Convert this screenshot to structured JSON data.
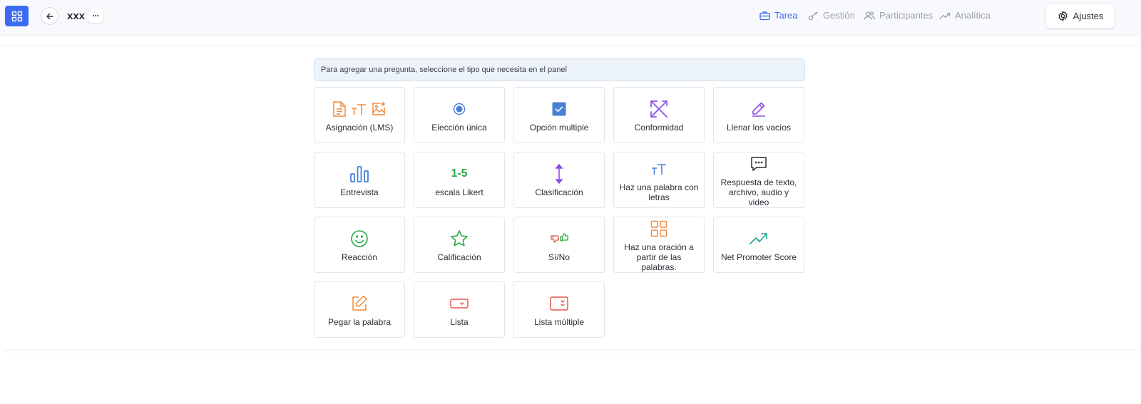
{
  "header": {
    "project_title": "xxx",
    "more_glyph": "···",
    "nav": [
      {
        "label": "Tarea",
        "icon": "briefcase-icon",
        "active": true
      },
      {
        "label": "Gestión",
        "icon": "key-icon",
        "active": false
      },
      {
        "label": "Participantes",
        "icon": "users-icon",
        "active": false
      },
      {
        "label": "Analítica",
        "icon": "trending-up-icon",
        "active": false
      }
    ],
    "settings_label": "Ajustes"
  },
  "hint": "Para agregar una pregunta, seleccione el tipo que necesita en el panel",
  "question_types": [
    {
      "label": "Asignación (LMS)",
      "icon": "document-text-image-icon"
    },
    {
      "label": "Elección única",
      "icon": "radio-icon"
    },
    {
      "label": "Opción multiple",
      "icon": "checkbox-icon"
    },
    {
      "label": "Conformidad",
      "icon": "match-arrows-icon"
    },
    {
      "label": "Llenar los vacíos",
      "icon": "pencil-icon"
    },
    {
      "label": "Entrevista",
      "icon": "bar-chart-icon"
    },
    {
      "label": "escala Likert",
      "icon": "likert-scale-icon",
      "icon_text": "1-5"
    },
    {
      "label": "Clasificación",
      "icon": "sort-arrows-icon"
    },
    {
      "label": "Haz una palabra con letras",
      "icon": "text-size-icon"
    },
    {
      "label": "Respuesta de texto, archivo, audio y video",
      "icon": "message-icon"
    },
    {
      "label": "Reacción",
      "icon": "smile-icon"
    },
    {
      "label": "Calificación",
      "icon": "star-icon"
    },
    {
      "label": "Sí/No",
      "icon": "thumbs-icon"
    },
    {
      "label": "Haz una oración a partir de las palabras.",
      "icon": "grid-icon"
    },
    {
      "label": "Net Promoter Score",
      "icon": "trending-up-icon"
    },
    {
      "label": "Pegar la palabra",
      "icon": "edit-icon"
    },
    {
      "label": "Lista",
      "icon": "dropdown-icon"
    },
    {
      "label": "Lista múltiple",
      "icon": "multi-dropdown-icon"
    }
  ],
  "colors": {
    "accent": "#3b6bf2",
    "orange": "#f08a3c",
    "blue": "#4a7fd6",
    "purple": "#8b4fe8",
    "green": "#27a844",
    "red": "#e8554d",
    "teal": "#1aa593"
  }
}
